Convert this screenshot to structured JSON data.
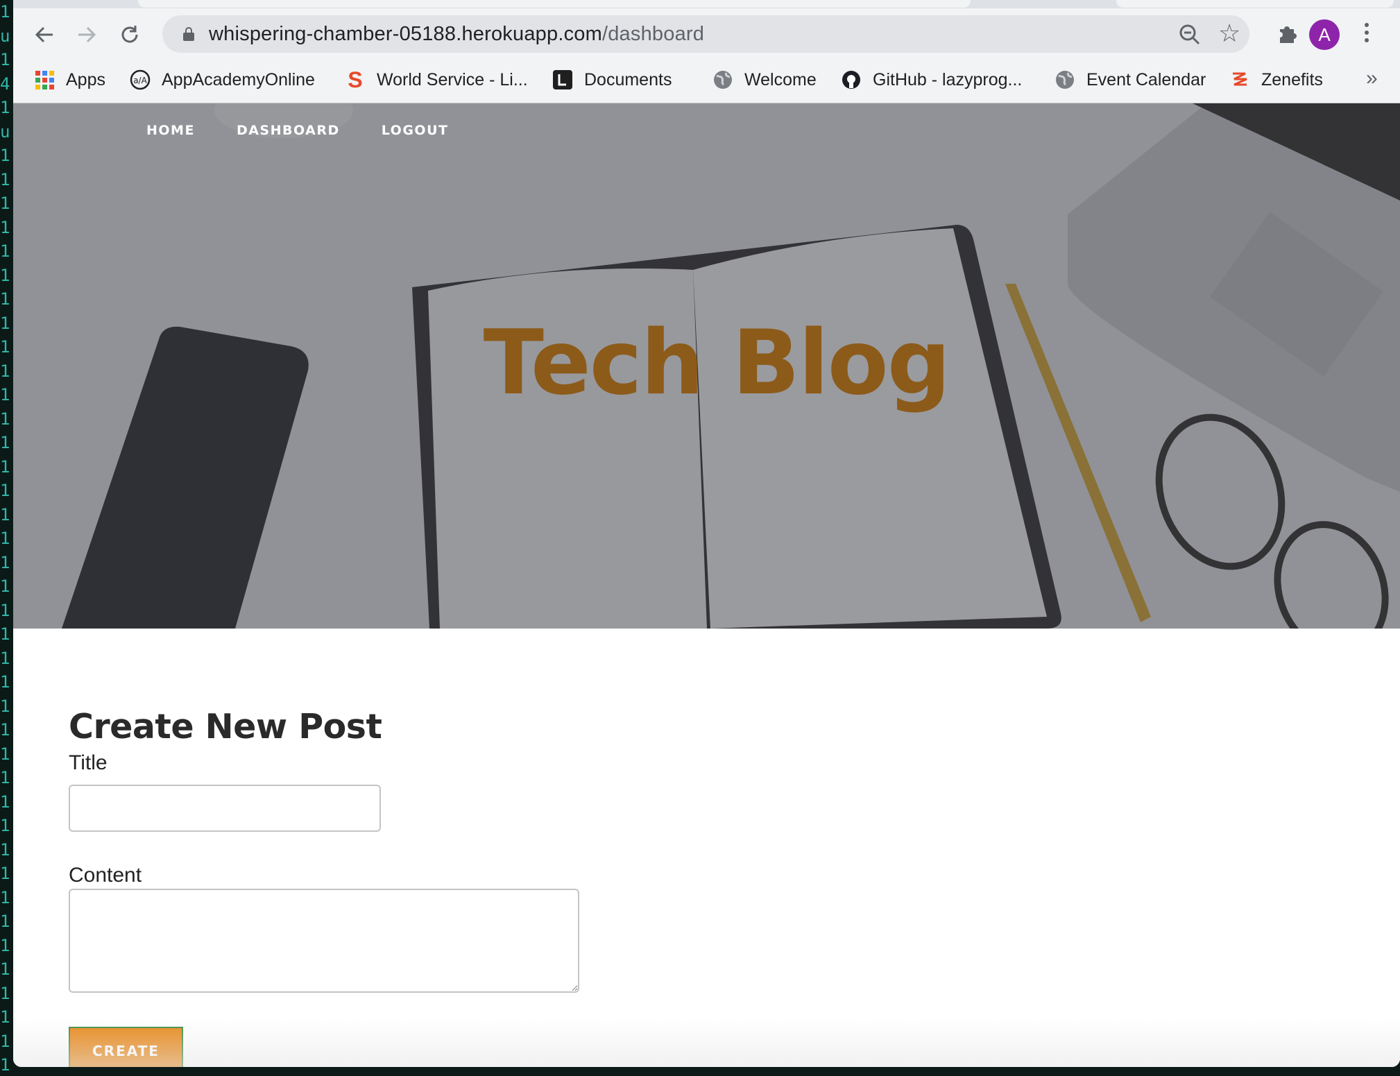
{
  "terminal": {
    "lines": "1\nu\n1\n4\n1\nu\n1\n1\n1\n1\n1\n1\n1\n1\n1\n1\n1\n1\n1\n1\n1\n1\n1\n1\n1\n1\n1\n1\n1\n1\n1\n1\n1\n1\n1\n1\n1\n1\n1\n1\n1\n1\n1\n1\n1"
  },
  "browser": {
    "url_host": "whispering-chamber-05188.herokuapp.com",
    "url_path": "/dashboard",
    "avatar_letter": "A",
    "bookmarks": [
      {
        "label": "Apps",
        "icon": "apps-grid-icon"
      },
      {
        "label": "AppAcademyOnline",
        "icon": "appacademy-icon"
      },
      {
        "label": "World Service - Li...",
        "icon": "s-logo-icon"
      },
      {
        "label": "Documents",
        "icon": "documents-icon"
      },
      {
        "label": "Welcome",
        "icon": "globe-icon"
      },
      {
        "label": "GitHub - lazyprog...",
        "icon": "github-icon"
      },
      {
        "label": "Event Calendar",
        "icon": "globe-icon"
      },
      {
        "label": "Zenefits",
        "icon": "zenefits-icon"
      }
    ],
    "more_bookmarks": "»"
  },
  "nav": {
    "home": "HOME",
    "dashboard": "DASHBOARD",
    "logout": "LOGOUT"
  },
  "hero": {
    "title": "Tech Blog"
  },
  "form": {
    "heading": "Create New Post",
    "title_label": "Title",
    "title_value": "",
    "content_label": "Content",
    "content_value": "",
    "submit_label": "CREATE"
  },
  "colors": {
    "accent": "#e88a1e",
    "title_color": "#8c5b1a",
    "avatar": "#8e24aa"
  }
}
